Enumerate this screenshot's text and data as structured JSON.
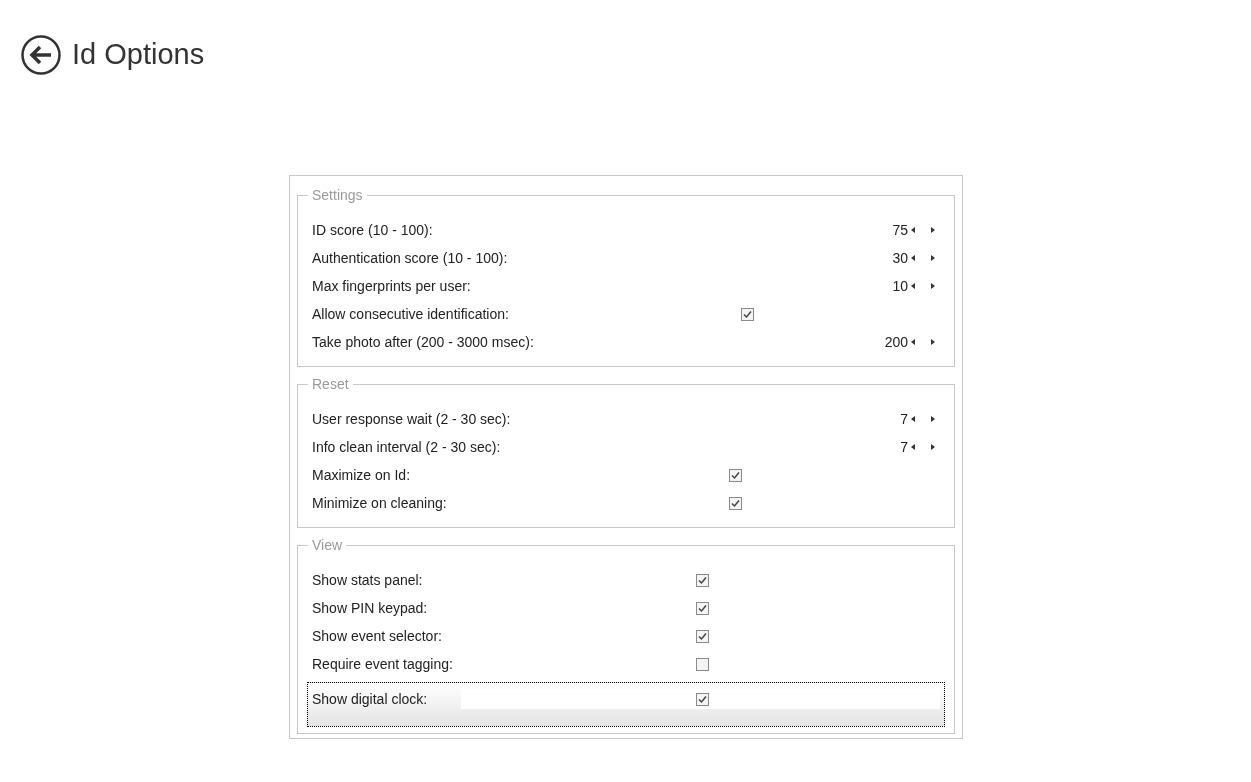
{
  "title": "Id Options",
  "groups": [
    {
      "legend": "Settings",
      "rows": [
        {
          "kind": "spinner",
          "label": "ID score (10 - 100):",
          "value": "75",
          "selected": false
        },
        {
          "kind": "spinner",
          "label": "Authentication score (10 - 100):",
          "value": "30",
          "selected": false
        },
        {
          "kind": "spinner",
          "label": "Max fingerprints per user:",
          "value": "10",
          "selected": false
        },
        {
          "kind": "checkbox",
          "label": "Allow consecutive identification:",
          "checked": true,
          "selected": false
        },
        {
          "kind": "spinner",
          "label": "Take photo after (200 - 3000 msec):",
          "value": "200",
          "selected": false
        }
      ]
    },
    {
      "legend": "Reset",
      "rows": [
        {
          "kind": "spinner",
          "label": "User response wait (2 - 30 sec):",
          "value": "7",
          "selected": false
        },
        {
          "kind": "spinner",
          "label": "Info clean interval (2 - 30 sec):",
          "value": "7",
          "selected": false
        },
        {
          "kind": "checkbox",
          "label": "Maximize on Id:",
          "checked": true,
          "selected": false
        },
        {
          "kind": "checkbox",
          "label": "Minimize on cleaning:",
          "checked": true,
          "selected": false
        }
      ]
    },
    {
      "legend": "View",
      "rows": [
        {
          "kind": "checkbox",
          "label": "Show stats panel:",
          "checked": true,
          "selected": false
        },
        {
          "kind": "checkbox",
          "label": "Show PIN keypad:",
          "checked": true,
          "selected": false
        },
        {
          "kind": "checkbox",
          "label": "Show event selector:",
          "checked": true,
          "selected": false
        },
        {
          "kind": "checkbox",
          "label": "Require event tagging:",
          "checked": false,
          "selected": false
        },
        {
          "kind": "checkbox",
          "label": "Show digital clock:",
          "checked": true,
          "selected": true
        }
      ]
    }
  ]
}
